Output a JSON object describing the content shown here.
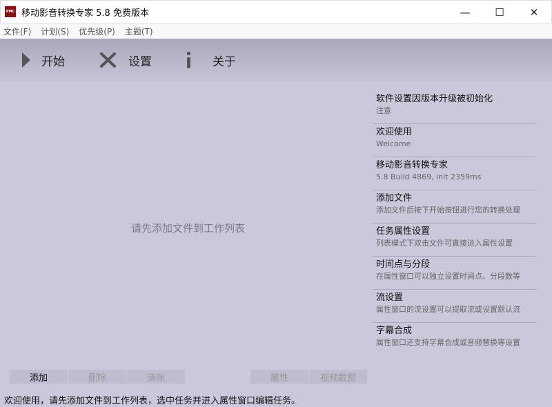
{
  "window": {
    "title": "移动影音转换专家 5.8 免费版本",
    "logo_text": "PMC",
    "minimize": "—",
    "maximize": "☐",
    "close": "✕"
  },
  "menu": [
    "文件(F)",
    "计划(S)",
    "优先级(P)",
    "主题(T)"
  ],
  "toolbar": {
    "start": "开始",
    "settings": "设置",
    "about": "关于"
  },
  "main": {
    "empty_text": "请先添加文件到工作列表"
  },
  "tips": [
    {
      "title": "软件设置因版本升级被初始化",
      "sub": "注意"
    },
    {
      "title": "欢迎使用",
      "sub": "Welcome"
    },
    {
      "title": "移动影音转换专家",
      "sub": "5.8 Build 4869, init 2359ms"
    },
    {
      "title": "添加文件",
      "sub": "添加文件后按下开始按钮进行您的转换处理"
    },
    {
      "title": "任务属性设置",
      "sub": "列表模式下双击文件可直接进入属性设置"
    },
    {
      "title": "时间点与分段",
      "sub": "在属性窗口可以独立设置时间点、分段数等"
    },
    {
      "title": "流设置",
      "sub": "属性窗口的流设置可以提取流或设置默认流"
    },
    {
      "title": "字幕合成",
      "sub": "属性窗口还支持字幕合成或音频替换等设置"
    }
  ],
  "buttons": {
    "add": "添加",
    "delete": "删除",
    "clear": "清除",
    "properties": "属性",
    "screenshot": "视频截图"
  },
  "status": "欢迎使用，请先添加文件到工作列表，选中任务并进入属性窗口编辑任务。"
}
